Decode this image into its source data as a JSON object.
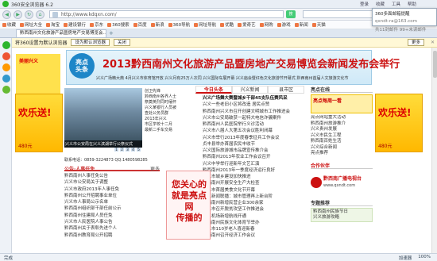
{
  "browser": {
    "title": "360安全浏览器 6.2",
    "title_right": [
      "登录",
      "收藏",
      "工具",
      "帮助"
    ],
    "url": "http://www.kdqxn.com/",
    "go_label": "搜",
    "popup": {
      "line1": "360多面邮箱提醒",
      "line2": "qxndt-ra@163.com",
      "line3": "共11封邮件 99+未读邮件"
    },
    "favorites": [
      "收藏",
      "网址大全",
      "淘宝",
      "建设银行",
      "京东",
      "360搜索",
      "百度",
      "新浪",
      "360导航",
      "网址导航",
      "优酷",
      "爱奇艺",
      "网购",
      "游戏",
      "新闻",
      "天猫"
    ],
    "tab_title": "黔西南州文化旅游产品暨房地产交易博览会...",
    "infobar": {
      "text": "将360设置为默认浏览器",
      "btn1": "设为默认浏览器",
      "btn2": "关闭",
      "more": "更多"
    },
    "status": {
      "left": "完成",
      "right": [
        "加速器",
        "100%"
      ]
    }
  },
  "page": {
    "banner": {
      "badge": "亮点\n头条",
      "title": "2013黔西南州文化旅游产品暨房地产交易博览会新闻发布会举行",
      "sub": "兴义广场精大典  4月兴义市体育馆开放  兴义月有25万人次同  兴义国际车展开幕  兴义庙会暨红色文化旅游节开幕式  黔西南州首届人文旅游文化节"
    },
    "left_ad": {
      "title": "美丽兴义",
      "big": "欢乐送!",
      "small": "480元",
      "sub": "半价送"
    },
    "right_ad": {
      "title": "迎新春",
      "big": "欢乐送!",
      "small": "480元",
      "sub": "现价"
    },
    "photo_caption": "兴义市公安局在兴义滨湖举行公祭仪式",
    "photo_nav": [
      "1",
      "2",
      "3",
      "4",
      "5"
    ],
    "side_news": [
      "创卫先锋",
      "黔西南州各界人士",
      "祭奠英烈同时缅怀",
      "兴义某银行人员被",
      "查处公务员群",
      "2013年兴义",
      "市区学校十二月",
      "最新二手车交易"
    ],
    "phone": "联系电话：0859-3224873  QQ:1480598285",
    "left_section": {
      "title": "公告·人事任免",
      "more": "更多",
      "items": [
        "黔西南州人事任免公告",
        "兴义市公安局关于调整",
        "兴义市政府2013年人事任免",
        "黔西南州公开招聘事业单位",
        "兴义市人事局公示名单",
        "黔西南州组织部干部任前公示",
        "黔西南州住建局人员任免",
        "兴义市人民医院人事公告",
        "黔西南州关于表彰先进个人",
        "黔西南州教育局公开招聘"
      ]
    },
    "tabs": [
      "今日头条",
      "兴义新闻",
      "县市区"
    ],
    "headline": "兴义广场舞大赛暨城乡干部45支队伍赛风采",
    "news": [
      "兴义广场舞大赛暨城乡干部45支队伍赛风采",
      "兴义一些老旧小区将改造 居民点赞",
      "黔西南州兴义市召开创建文明城市工作推进会",
      "兴义市公安局破获一起特大电信诈骗案件",
      "黔西南州人民医院举行义诊活动",
      "兴义市八届人大第五次会议胜利闭幕",
      "兴义市举行2013年度春季征兵工作会议",
      "贞丰县举办首届农民丰收节",
      "兴义国际旅游城市品牌宣传推介会",
      "黔西南州2013年农业工作会议召开",
      "兴义中学举行迎新年文艺汇演",
      "黔西南州2013年一季度经济运行良好",
      "兴义市城乡建设加快推进",
      "黔西南州开展安全生产大检查",
      "兴义市首届美食文化节开幕",
      "兴义新闻联播：城市管理再上新台阶",
      "黔西南州新增民营企业300余家",
      "兴义市召开脱贫攻坚工作推进会",
      "兴义机场新增航线开通",
      "黔西南州民族文化体育节举办",
      "兴义市110岁老人喜迎新春",
      "黔西南州召开经济工作会议"
    ],
    "vert_ad": "您关心的\n就是亮点网\n传播的",
    "right_section": {
      "title": "亮点在线",
      "hot": "亮点每周一看",
      "items": [
        "亮点网站重大活动",
        "黔西南州旅游推介",
        "兴义贵州发展",
        "兴义市民生工程",
        "黔西南百姓生活",
        "兴义综合新闻",
        "亮点推荐"
      ],
      "partner_title": "合作伙伴",
      "partner": "黔西南广播电视台",
      "partner_url": "www.qxndt.com",
      "recommend": "专题推荐",
      "rec_items": [
        "黔西南州民族节日",
        "兴义旅游攻略"
      ]
    }
  }
}
